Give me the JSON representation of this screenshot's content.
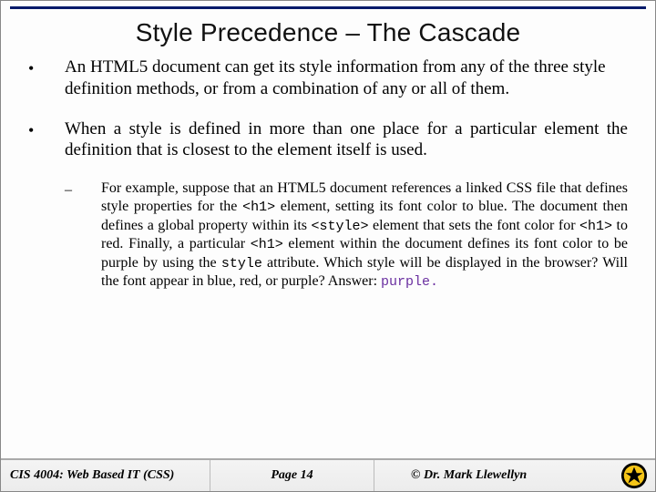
{
  "title": "Style Precedence – The Cascade",
  "bullets": [
    {
      "text": "An HTML5 document can get its style information from any of the three style definition methods, or from a combination of any or all of them.",
      "justify": false
    },
    {
      "text": "When a style is defined in more than one place for a particular element the definition that is closest to the element itself is used.",
      "justify": true
    }
  ],
  "sub": {
    "prefix1": "For example, suppose that an HTML5 document references a linked CSS file that defines style properties for the ",
    "code1": "<h1>",
    "mid1": " element, setting its font color to blue.  The document then defines a global property within its ",
    "code2": "<style>",
    "mid2": " element that sets the font color for ",
    "code3": "<h1>",
    "mid3": "  to red.  Finally, a particular ",
    "code4": "<h1>",
    "mid4": " element within the document defines its font color to be purple by using the ",
    "code5": "style",
    "mid5": " attribute.  Which style will be displayed in the browser?  Will the font appear in blue, red, or purple?  Answer:   ",
    "answer": "purple."
  },
  "footer": {
    "left": "CIS 4004: Web Based IT (CSS)",
    "mid": "Page 14",
    "right": "© Dr. Mark Llewellyn"
  }
}
